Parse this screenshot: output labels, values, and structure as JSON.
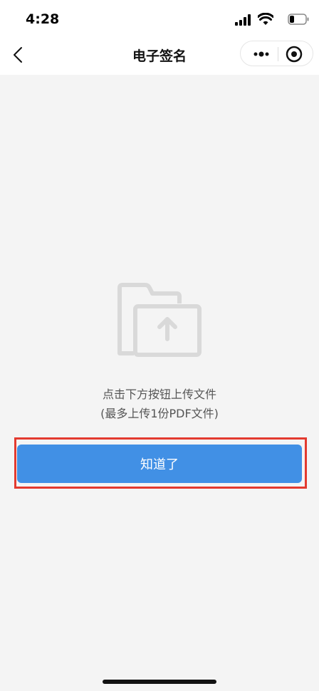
{
  "status_bar": {
    "time": "4:28",
    "icons": [
      "signal-icon",
      "wifi-icon",
      "battery-icon"
    ]
  },
  "nav": {
    "back_icon": "chevron-left-icon",
    "title": "电子签名",
    "capsule": {
      "more_icon": "more-dots-icon",
      "target_icon": "target-icon"
    }
  },
  "main": {
    "upload_icon": "folder-upload-icon",
    "hint_line1": "点击下方按钮上传文件",
    "hint_line2": "(最多上传1份PDF文件)",
    "button_label": "知道了"
  },
  "colors": {
    "button": "#4190e5",
    "highlight_border": "#e33a2f",
    "background": "#f4f4f4"
  }
}
